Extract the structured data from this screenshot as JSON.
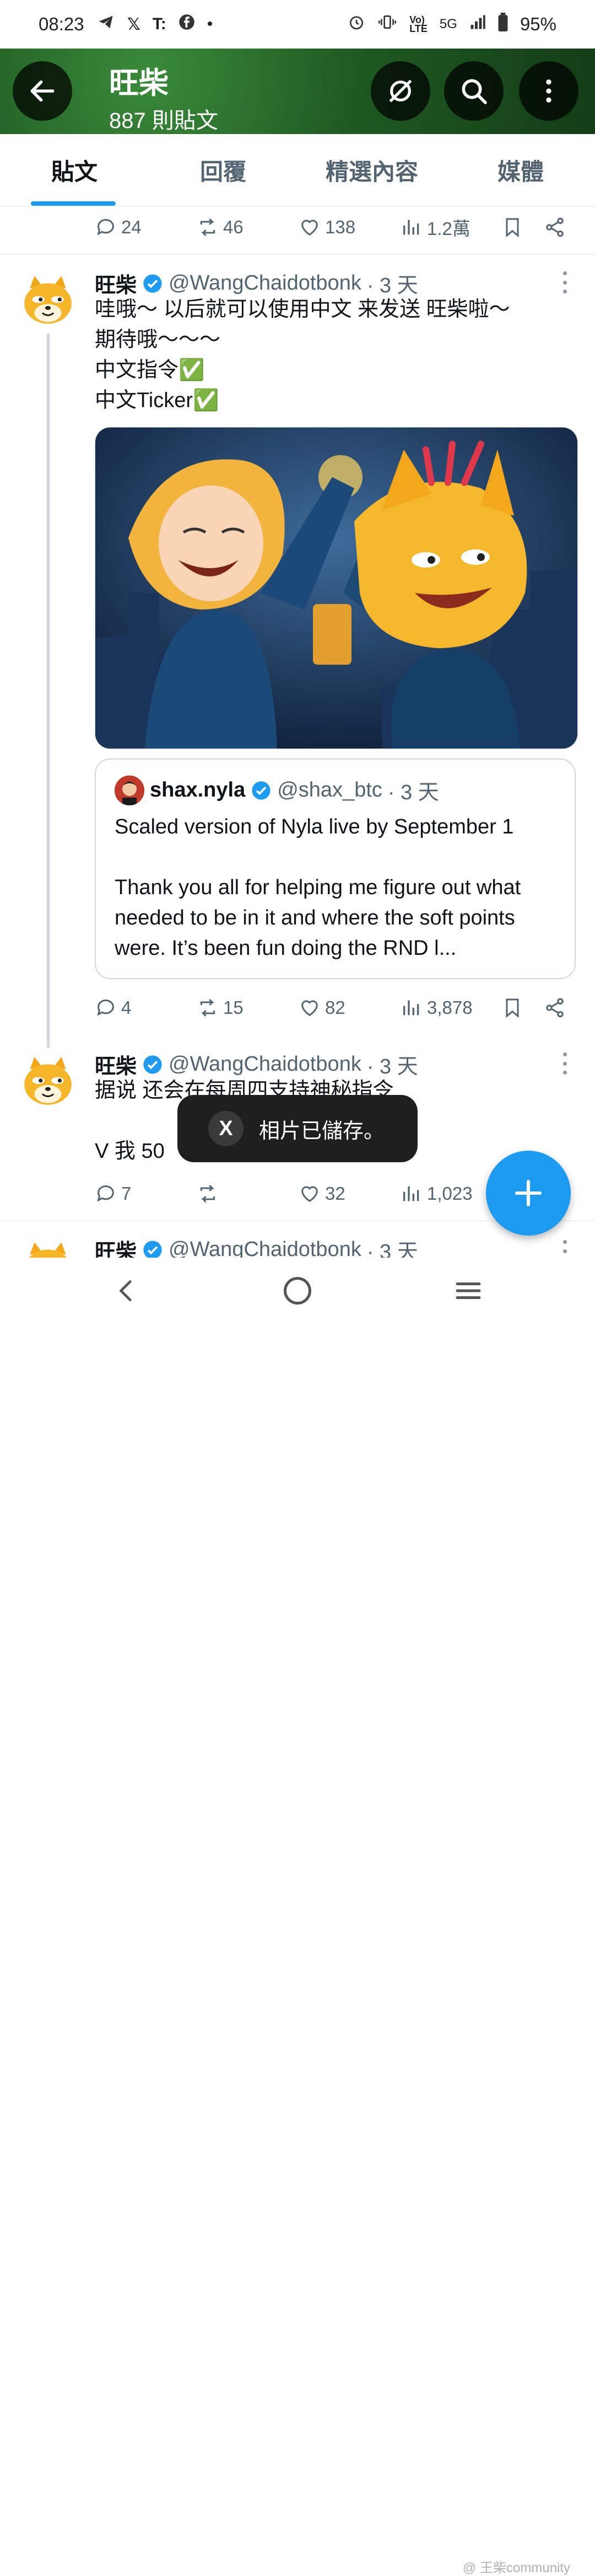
{
  "status_bar": {
    "time": "08:23",
    "notif_icons": [
      "telegram-icon",
      "x-icon",
      "t-icon",
      "facebook-icon",
      "dot-icon"
    ],
    "system_icons": [
      "alarm-icon",
      "vibrate-icon",
      "volte-icon",
      "signal-icon",
      "battery-icon"
    ],
    "network": "5G",
    "battery": "95%"
  },
  "header": {
    "title": "旺柴",
    "subtitle": "887 則貼文",
    "colors": {
      "banner": "#1f5a22"
    }
  },
  "tabs": [
    {
      "label": "貼文",
      "active": true
    },
    {
      "label": "回覆",
      "active": false
    },
    {
      "label": "精選內容",
      "active": false
    },
    {
      "label": "媒體",
      "active": false
    }
  ],
  "top_actions": {
    "replies": "24",
    "reposts": "46",
    "likes": "138",
    "views": "1.2萬"
  },
  "tweets": [
    {
      "name": "旺柴",
      "handle": "@WangChaidotbonk",
      "time": "· 3 天",
      "text": "哇哦～ 以后就可以使用中文 来发送 旺柴啦～\n期待哦～～～\n中文指令✅\n中文Ticker✅",
      "quote": {
        "name": "shax.nyla",
        "handle": "@shax_btc",
        "time": "· 3 天",
        "text": "Scaled version of Nyla live by September 1\n\nThank you all for helping me figure out what needed to be in it and where the soft points were. It’s been fun doing the RND l..."
      },
      "actions": {
        "replies": "4",
        "reposts": "15",
        "likes": "82",
        "views": "3,878"
      }
    },
    {
      "name": "旺柴",
      "handle": "@WangChaidotbonk",
      "time": "· 3 天",
      "text": "据说 还会在每周四支持神秘指令\n\nV 我 50",
      "actions": {
        "replies": "7",
        "reposts": "",
        "likes": "32",
        "views": "1,023"
      }
    },
    {
      "name": "旺柴",
      "handle": "@WangChaidotbonk",
      "time": "· 3 天"
    }
  ],
  "toast": {
    "text": "相片已儲存。",
    "logo": "X"
  },
  "watermark": "@ 王柴community",
  "accent_color": "#1d9bf0"
}
